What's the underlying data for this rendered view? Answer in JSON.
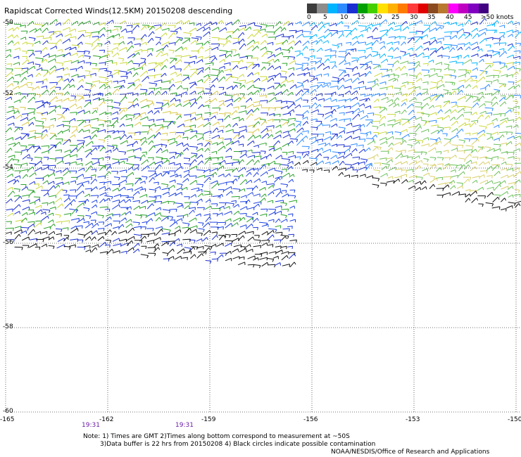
{
  "title": "Rapidscat Corrected Winds(12.5KM) 20150208 descending",
  "colorbar": {
    "labels": [
      "0",
      "5",
      "10",
      "15",
      "20",
      "25",
      "30",
      "35",
      "40",
      "45",
      ">50 knots"
    ],
    "colors": [
      "#3c3c3c",
      "#8c8c8c",
      "#00b4ff",
      "#2e8bff",
      "#1a2fd0",
      "#00a000",
      "#44d000",
      "#ffe000",
      "#ffb000",
      "#ff7a00",
      "#ff3a3a",
      "#e00000",
      "#8a4a20",
      "#b87830",
      "#ff00ff",
      "#c000c0",
      "#8000c0",
      "#400080"
    ]
  },
  "lat_labels": [
    "-50",
    "-52",
    "-54",
    "-56",
    "-58",
    "-60"
  ],
  "lon_labels": [
    "-165",
    "-162",
    "-159",
    "-156",
    "-153",
    "-150"
  ],
  "time_labels": [
    "19:31",
    "19:31"
  ],
  "notes": [
    "Note: 1) Times are GMT 2)Times along bottom correspond to measurement at ~50S",
    "3)Data buffer is 22 hrs from 20150208 4) Black circles indicate possible contamination",
    "NOAA/NESDIS/Office of Research and Applications"
  ]
}
